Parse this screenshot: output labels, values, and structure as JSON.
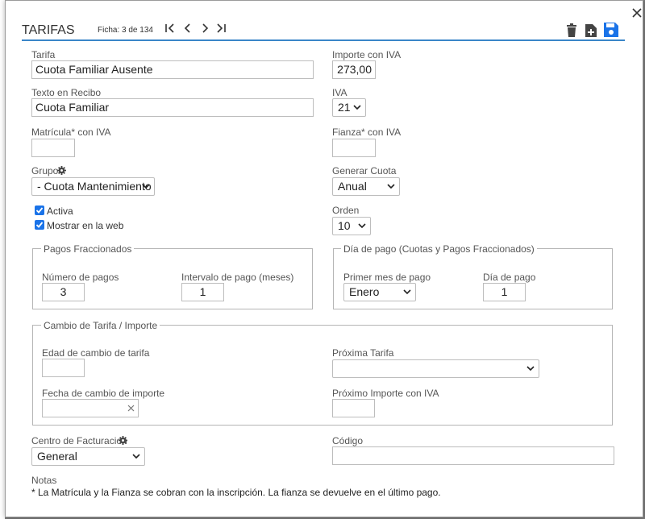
{
  "header": {
    "title": "TARIFAS",
    "record_counter": "Ficha: 3 de 134"
  },
  "fields": {
    "tarifa_label": "Tarifa",
    "tarifa_value": "Cuota Familiar Ausente",
    "importe_label": "Importe con IVA",
    "importe_value": "273,00",
    "texto_label": "Texto en Recibo",
    "texto_value": "Cuota Familiar",
    "iva_label": "IVA",
    "iva_value": "21",
    "matricula_label": "Matrícula* con IVA",
    "matricula_value": "",
    "fianza_label": "Fianza* con IVA",
    "fianza_value": "",
    "grupo_label": "Grupo",
    "grupo_value": "- Cuota Mantenimiento",
    "generar_label": "Generar Cuota",
    "generar_value": "Anual",
    "activa_label": "Activa",
    "activa_checked": true,
    "mostrar_label": "Mostrar en la web",
    "mostrar_checked": true,
    "orden_label": "Orden",
    "orden_value": "10"
  },
  "pagos_fraccionados": {
    "legend": "Pagos Fraccionados",
    "numero_label": "Número de pagos",
    "numero_value": "3",
    "intervalo_label": "Intervalo de pago (meses)",
    "intervalo_value": "1"
  },
  "dia_pago": {
    "legend": "Día de pago (Cuotas y Pagos Fraccionados)",
    "primer_mes_label": "Primer mes de pago",
    "primer_mes_value": "Enero",
    "dia_label": "Día de pago",
    "dia_value": "1"
  },
  "cambio_tarifa": {
    "legend": "Cambio de Tarifa / Importe",
    "edad_label": "Edad de cambio de tarifa",
    "edad_value": "",
    "proxima_tarifa_label": "Próxima Tarifa",
    "proxima_tarifa_value": "",
    "fecha_label": "Fecha de cambio de importe",
    "fecha_value": "",
    "proximo_importe_label": "Próximo Importe con IVA",
    "proximo_importe_value": ""
  },
  "facturacion": {
    "centro_label": "Centro de Facturacion",
    "centro_value": "General",
    "codigo_label": "Código",
    "codigo_value": ""
  },
  "notas": {
    "label": "Notas",
    "text": "* La Matrícula y la Fianza se cobran con la inscripción. La fianza se devuelve en el último pago."
  },
  "colors": {
    "accent": "#1a73e8",
    "header_line": "#3a86c8"
  }
}
